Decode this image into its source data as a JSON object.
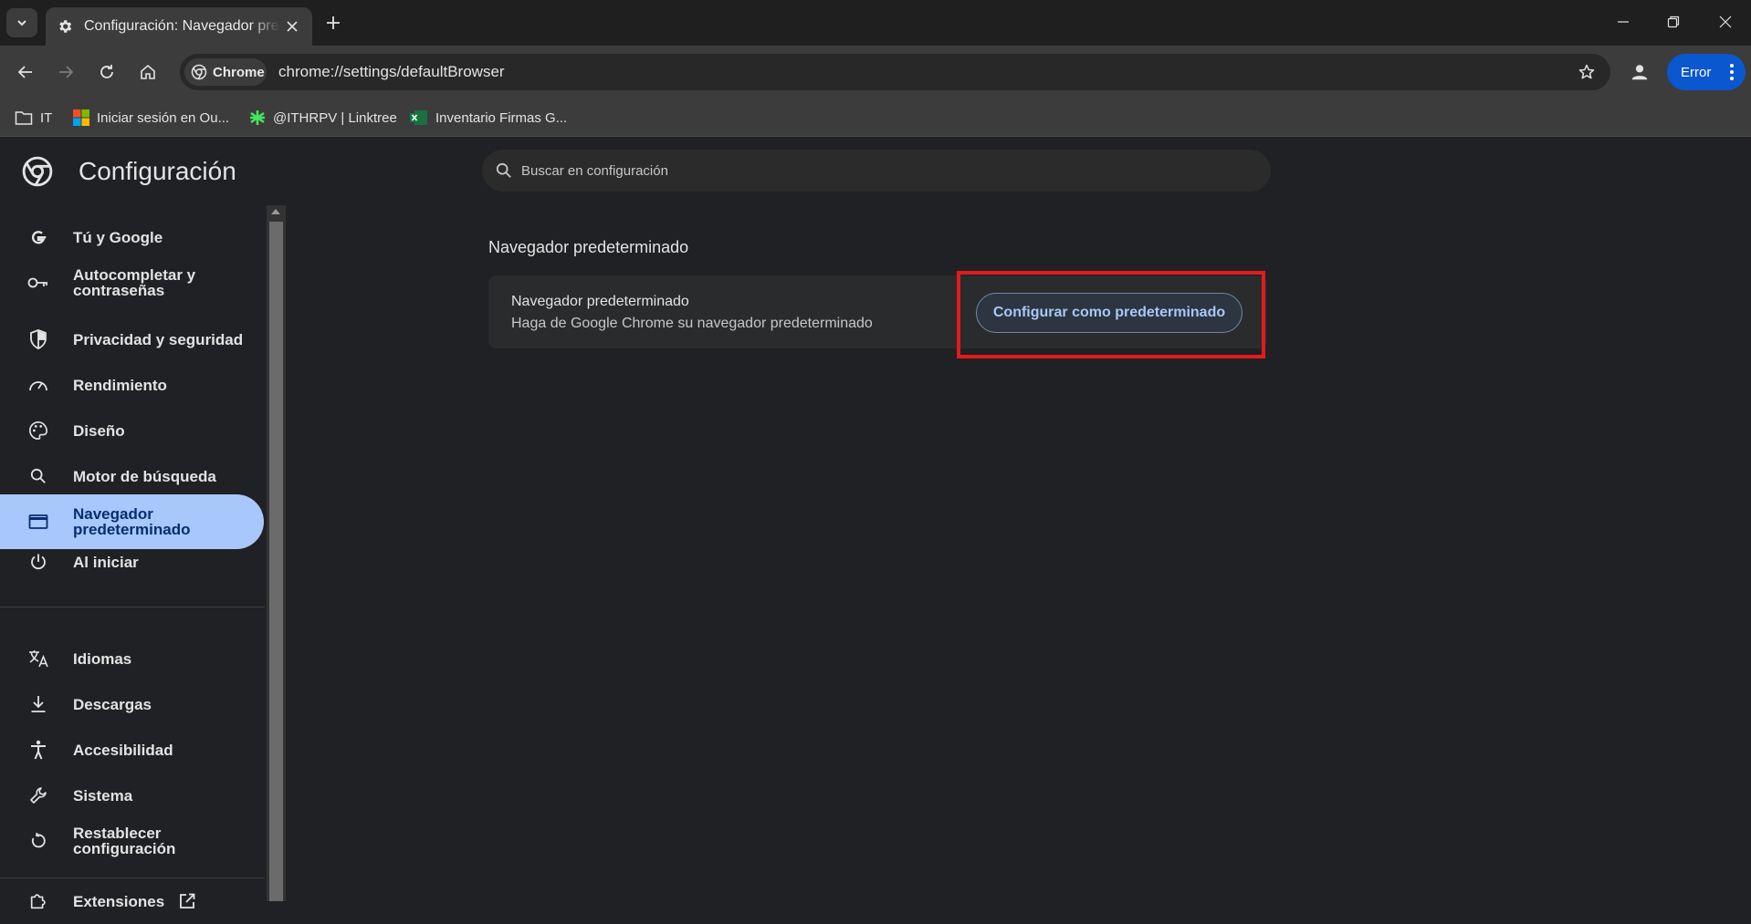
{
  "browser": {
    "tab_title": "Configuración: Navegador predeterminado",
    "url": "chrome://settings/defaultBrowser",
    "chip_label": "Chrome",
    "error_label": "Error"
  },
  "bookmarks": [
    {
      "label": "IT",
      "icon": "folder-icon"
    },
    {
      "label": "Iniciar sesión en Ou...",
      "icon": "microsoft-icon"
    },
    {
      "label": "@ITHRPV | Linktree",
      "icon": "linktree-icon"
    },
    {
      "label": "Inventario Firmas G...",
      "icon": "excel-icon"
    }
  ],
  "settings": {
    "title": "Configuración",
    "search_placeholder": "Buscar en configuración",
    "sidebar": [
      {
        "label": "Tú y Google",
        "icon": "google-icon"
      },
      {
        "label": "Autocompletar y contraseñas",
        "icon": "key-icon"
      },
      {
        "label": "Privacidad y seguridad",
        "icon": "shield-icon"
      },
      {
        "label": "Rendimiento",
        "icon": "speedometer-icon"
      },
      {
        "label": "Diseño",
        "icon": "palette-icon"
      },
      {
        "label": "Motor de búsqueda",
        "icon": "search-icon"
      },
      {
        "label": "Navegador predeterminado",
        "icon": "browser-window-icon",
        "active": true
      },
      {
        "label": "Al iniciar",
        "icon": "power-icon"
      },
      {
        "label": "Idiomas",
        "icon": "translate-icon"
      },
      {
        "label": "Descargas",
        "icon": "download-icon"
      },
      {
        "label": "Accesibilidad",
        "icon": "accessibility-icon"
      },
      {
        "label": "Sistema",
        "icon": "wrench-icon"
      },
      {
        "label": "Restablecer configuración",
        "icon": "restore-icon"
      },
      {
        "label": "Extensiones",
        "icon": "puzzle-icon"
      }
    ],
    "section_title": "Navegador predeterminado",
    "card": {
      "title": "Navegador predeterminado",
      "subtitle": "Haga de Google Chrome su navegador predeterminado",
      "button_label": "Configurar como predeterminado"
    }
  },
  "colors": {
    "accent": "#a8c7fa",
    "active_text": "#062e6f",
    "highlight": "#e21b1b",
    "error_button": "#0b57d0"
  }
}
